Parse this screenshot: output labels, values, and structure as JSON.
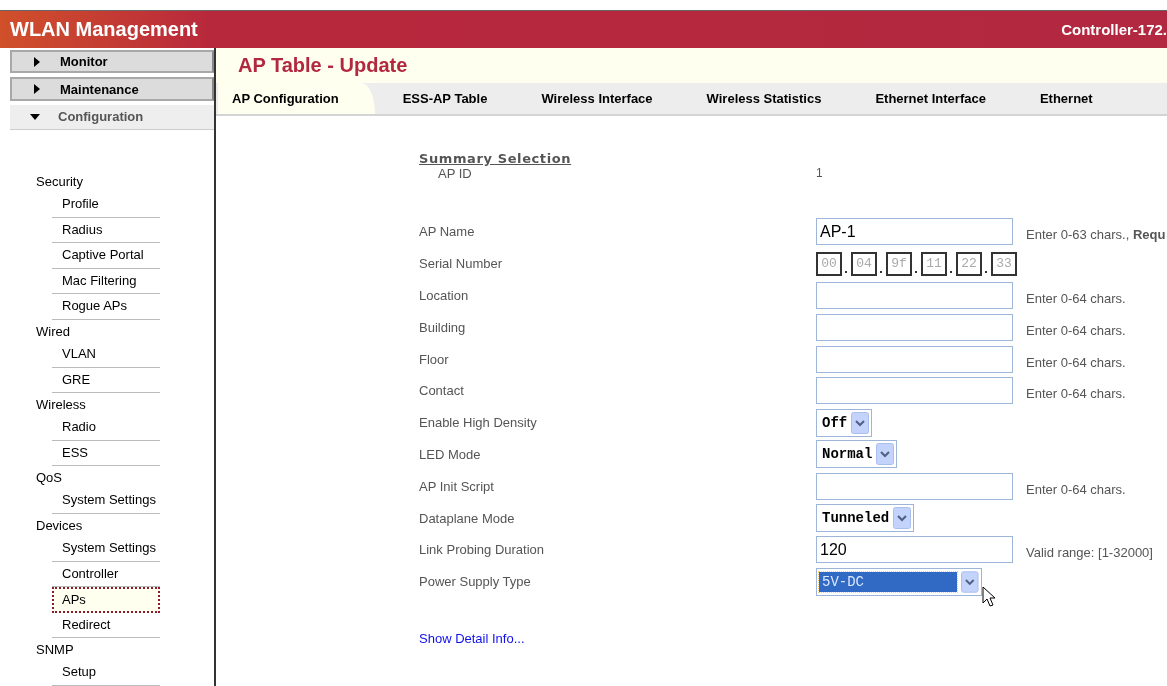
{
  "header": {
    "title": "WLAN Management",
    "controller": "Controller-172."
  },
  "menu": [
    {
      "label": "Monitor",
      "expanded": false
    },
    {
      "label": "Maintenance",
      "expanded": false
    },
    {
      "label": "Configuration",
      "expanded": true
    }
  ],
  "nav": [
    {
      "label": "Security",
      "children": [
        {
          "label": "Profile",
          "selected": false
        },
        {
          "label": "Radius",
          "selected": false
        },
        {
          "label": "Captive Portal",
          "selected": false
        },
        {
          "label": "Mac Filtering",
          "selected": false
        },
        {
          "label": "Rogue APs",
          "selected": false
        }
      ]
    },
    {
      "label": "Wired",
      "children": [
        {
          "label": "VLAN",
          "selected": false
        },
        {
          "label": "GRE",
          "selected": false
        }
      ]
    },
    {
      "label": "Wireless",
      "children": [
        {
          "label": "Radio",
          "selected": false
        },
        {
          "label": "ESS",
          "selected": false
        }
      ]
    },
    {
      "label": "QoS",
      "children": [
        {
          "label": "System Settings",
          "selected": false
        }
      ]
    },
    {
      "label": "Devices",
      "children": [
        {
          "label": "System Settings",
          "selected": false
        },
        {
          "label": "Controller",
          "selected": false
        },
        {
          "label": "APs",
          "selected": true
        },
        {
          "label": "Redirect",
          "selected": false
        }
      ]
    },
    {
      "label": "SNMP",
      "children": [
        {
          "label": "Setup",
          "selected": false
        }
      ]
    }
  ],
  "page_title": "AP Table - Update",
  "tabs": [
    {
      "label": "AP Configuration",
      "selected": true
    },
    {
      "label": "ESS-AP Table",
      "selected": false
    },
    {
      "label": "Wireless Interface",
      "selected": false
    },
    {
      "label": "Wireless Statistics",
      "selected": false
    },
    {
      "label": "Ethernet Interface",
      "selected": false
    },
    {
      "label": "Ethernet",
      "selected": false
    }
  ],
  "section_title": "Summary Selection",
  "fields": [
    {
      "kind": "static",
      "label": "AP ID",
      "value": "1"
    },
    {
      "kind": "text",
      "label": "AP Name",
      "value": "AP-1",
      "hint": "Enter 0-63 chars., **Requ**"
    },
    {
      "kind": "serial",
      "label": "Serial Number",
      "values": [
        "00",
        "04",
        "9f",
        "11",
        "22",
        "33"
      ]
    },
    {
      "kind": "text",
      "label": "Location",
      "hint": "Enter 0-64 chars."
    },
    {
      "kind": "text",
      "label": "Building",
      "hint": "Enter 0-64 chars."
    },
    {
      "kind": "text",
      "label": "Floor",
      "hint": "Enter 0-64 chars."
    },
    {
      "kind": "text",
      "label": "Contact",
      "hint": "Enter 0-64 chars."
    },
    {
      "kind": "select",
      "label": "Enable High Density",
      "value": "Off",
      "focused": false
    },
    {
      "kind": "select",
      "label": "LED Mode",
      "value": "Normal",
      "focused": false
    },
    {
      "kind": "text",
      "label": "AP Init Script",
      "hint": "Enter 0-64 chars."
    },
    {
      "kind": "select",
      "label": "Dataplane Mode",
      "value": "Tunneled",
      "focused": false
    },
    {
      "kind": "text",
      "label": "Link Probing Duration",
      "value": "120",
      "hint": "Valid range: [1-32000]"
    },
    {
      "kind": "select",
      "label": "Power Supply Type",
      "value": "5V-DC",
      "focused": true
    }
  ],
  "detail_link": "Show Detail Info..."
}
